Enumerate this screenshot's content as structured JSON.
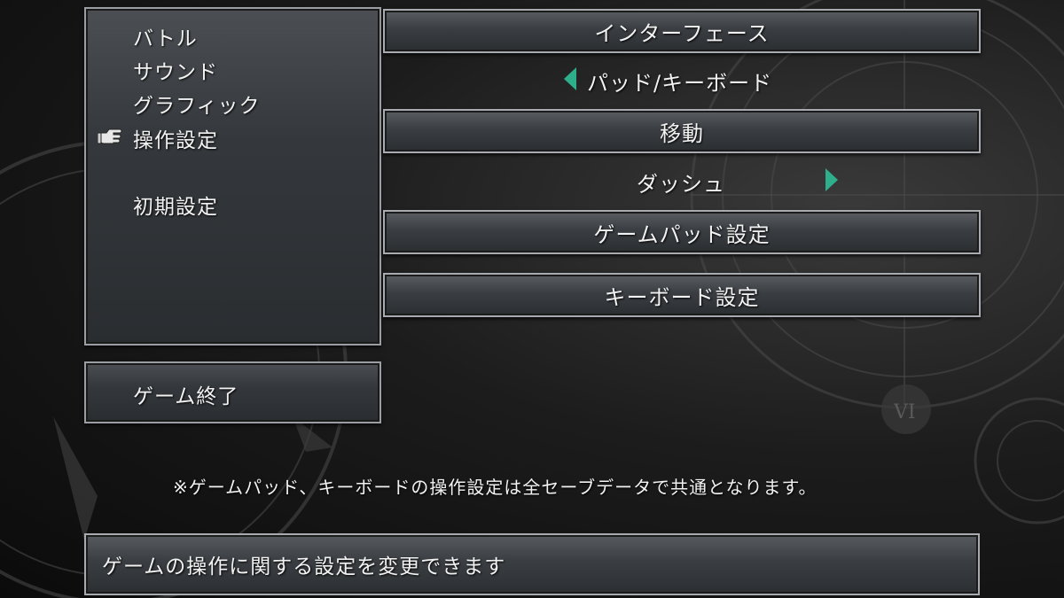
{
  "side_menu": {
    "items": [
      {
        "label": "バトル"
      },
      {
        "label": "サウンド"
      },
      {
        "label": "グラフィック"
      },
      {
        "label": "操作設定",
        "selected": true
      },
      {
        "label": "初期設定"
      }
    ],
    "exit_label": "ゲーム終了"
  },
  "settings": {
    "interface_header": "インターフェース",
    "interface_value": "パッド/キーボード",
    "movement_header": "移動",
    "movement_value": "ダッシュ",
    "gamepad_button": "ゲームパッド設定",
    "keyboard_button": "キーボード設定"
  },
  "note": "※ゲームパッド、キーボードの操作設定は全セーブデータで共通となります。",
  "help_text": "ゲームの操作に関する設定を変更できます",
  "colors": {
    "arrow": "#2fae8c",
    "panel_border": "#a7abaf"
  },
  "icons": {
    "cursor": "pointing-hand-icon",
    "background": "clock-face-emblem"
  }
}
